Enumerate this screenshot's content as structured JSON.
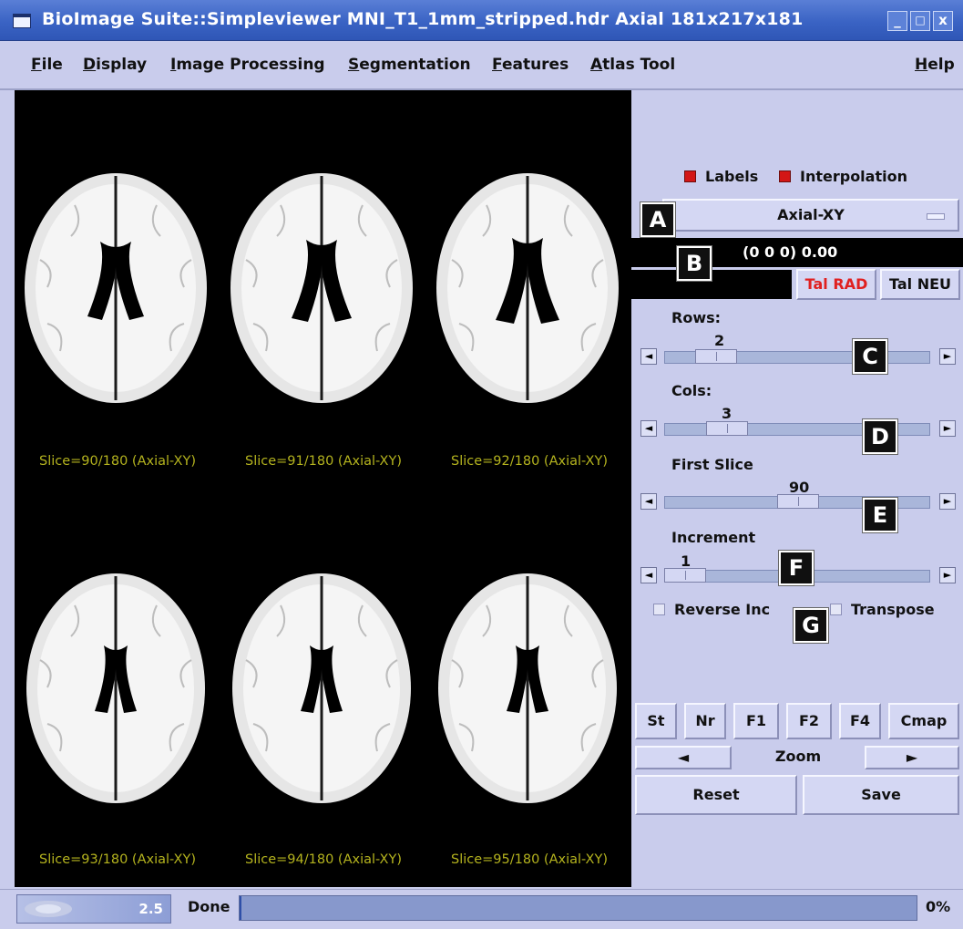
{
  "window": {
    "title": "BioImage Suite::Simpleviewer MNI_T1_1mm_stripped.hdr Axial 181x217x181",
    "minimize": "_",
    "maximize": "□",
    "close": "x"
  },
  "menu": {
    "file": {
      "first": "F",
      "rest": "ile"
    },
    "display": {
      "first": "D",
      "rest": "isplay"
    },
    "image_processing": {
      "first": "I",
      "rest": "mage Processing"
    },
    "segmentation": {
      "first": "S",
      "rest": "egmentation"
    },
    "features": {
      "first": "F",
      "rest": "eatures"
    },
    "atlas_tool": {
      "first": "A",
      "rest": "tlas Tool"
    },
    "help": {
      "first": "H",
      "rest": "elp"
    }
  },
  "viewer": {
    "slices": [
      {
        "label": "Slice=90/180 (Axial-XY)"
      },
      {
        "label": "Slice=91/180 (Axial-XY)"
      },
      {
        "label": "Slice=92/180 (Axial-XY)"
      },
      {
        "label": "Slice=93/180 (Axial-XY)"
      },
      {
        "label": "Slice=94/180 (Axial-XY)"
      },
      {
        "label": "Slice=95/180 (Axial-XY)"
      }
    ]
  },
  "panel": {
    "labels_check": "Labels",
    "labels_checked": true,
    "interpolation_check": "Interpolation",
    "interpolation_checked": true,
    "orientation_value": "Axial-XY",
    "coordinates": "(0 0 0) 0.00",
    "tal_rad": "Tal RAD",
    "tal_neu": "Tal NEU",
    "rows": {
      "label": "Rows:",
      "value": "2"
    },
    "cols": {
      "label": "Cols:",
      "value": "3"
    },
    "first_slice": {
      "label": "First Slice",
      "value": "90"
    },
    "increment": {
      "label": "Increment",
      "value": "1"
    },
    "reverse_inc": "Reverse Inc",
    "reverse_inc_checked": false,
    "transpose": "Transpose",
    "transpose_checked": false,
    "buttons": [
      "St",
      "Nr",
      "F1",
      "F2",
      "F4",
      "Cmap"
    ],
    "zoom_label": "Zoom",
    "zoom_left": "◄",
    "zoom_right": "►",
    "reset": "Reset",
    "save": "Save",
    "callouts": [
      "A",
      "B",
      "C",
      "D",
      "E",
      "F",
      "G"
    ]
  },
  "status": {
    "zoom_value": "2.5",
    "text": "Done",
    "progress_percent": "0%",
    "progress_fraction": 0
  },
  "colors": {
    "background": "#c9ccec",
    "title_bar": "#3a63c4",
    "slice_label": "#b4b31e",
    "tal_rad_text": "#e02020",
    "checkbox_on": "#d31616"
  }
}
